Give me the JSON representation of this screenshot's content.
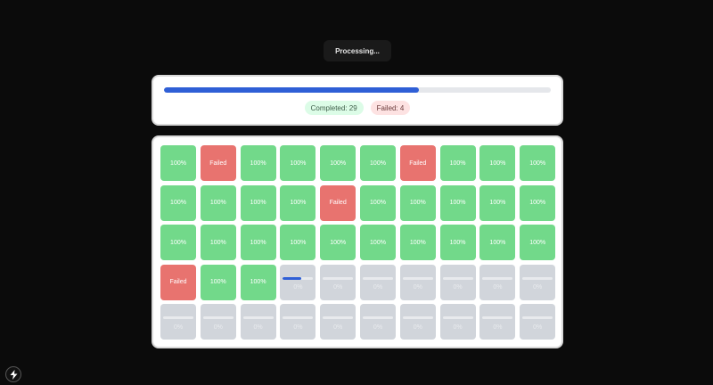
{
  "status": {
    "processing_label": "Processing..."
  },
  "overall_progress": 0.66,
  "stats": {
    "completed_label": "Completed: 29",
    "failed_label": "Failed: 4"
  },
  "colors": {
    "accent": "#2f5fd6",
    "success": "#72d98a",
    "error": "#e8736f",
    "pending": "#d1d5db"
  },
  "tiles": [
    {
      "state": "done",
      "label": "100%"
    },
    {
      "state": "failed",
      "label": "Failed"
    },
    {
      "state": "done",
      "label": "100%"
    },
    {
      "state": "done",
      "label": "100%"
    },
    {
      "state": "done",
      "label": "100%"
    },
    {
      "state": "done",
      "label": "100%"
    },
    {
      "state": "failed",
      "label": "Failed"
    },
    {
      "state": "done",
      "label": "100%"
    },
    {
      "state": "done",
      "label": "100%"
    },
    {
      "state": "done",
      "label": "100%"
    },
    {
      "state": "done",
      "label": "100%"
    },
    {
      "state": "done",
      "label": "100%"
    },
    {
      "state": "done",
      "label": "100%"
    },
    {
      "state": "done",
      "label": "100%"
    },
    {
      "state": "failed",
      "label": "Failed"
    },
    {
      "state": "done",
      "label": "100%"
    },
    {
      "state": "done",
      "label": "100%"
    },
    {
      "state": "done",
      "label": "100%"
    },
    {
      "state": "done",
      "label": "100%"
    },
    {
      "state": "done",
      "label": "100%"
    },
    {
      "state": "done",
      "label": "100%"
    },
    {
      "state": "done",
      "label": "100%"
    },
    {
      "state": "done",
      "label": "100%"
    },
    {
      "state": "done",
      "label": "100%"
    },
    {
      "state": "done",
      "label": "100%"
    },
    {
      "state": "done",
      "label": "100%"
    },
    {
      "state": "done",
      "label": "100%"
    },
    {
      "state": "done",
      "label": "100%"
    },
    {
      "state": "done",
      "label": "100%"
    },
    {
      "state": "done",
      "label": "100%"
    },
    {
      "state": "failed",
      "label": "Failed"
    },
    {
      "state": "done",
      "label": "100%"
    },
    {
      "state": "done",
      "label": "100%"
    },
    {
      "state": "active",
      "label": "0%",
      "progress": 0.6
    },
    {
      "state": "pending",
      "label": "0%",
      "progress": 0
    },
    {
      "state": "pending",
      "label": "0%",
      "progress": 0
    },
    {
      "state": "pending",
      "label": "0%",
      "progress": 0
    },
    {
      "state": "pending",
      "label": "0%",
      "progress": 0
    },
    {
      "state": "pending",
      "label": "0%",
      "progress": 0
    },
    {
      "state": "pending",
      "label": "0%",
      "progress": 0
    },
    {
      "state": "pending",
      "label": "0%",
      "progress": 0
    },
    {
      "state": "pending",
      "label": "0%",
      "progress": 0
    },
    {
      "state": "pending",
      "label": "0%",
      "progress": 0
    },
    {
      "state": "pending",
      "label": "0%",
      "progress": 0
    },
    {
      "state": "pending",
      "label": "0%",
      "progress": 0
    },
    {
      "state": "pending",
      "label": "0%",
      "progress": 0
    },
    {
      "state": "pending",
      "label": "0%",
      "progress": 0
    },
    {
      "state": "pending",
      "label": "0%",
      "progress": 0
    },
    {
      "state": "pending",
      "label": "0%",
      "progress": 0
    },
    {
      "state": "pending",
      "label": "0%",
      "progress": 0
    }
  ],
  "corner_icon": "lightning-icon"
}
